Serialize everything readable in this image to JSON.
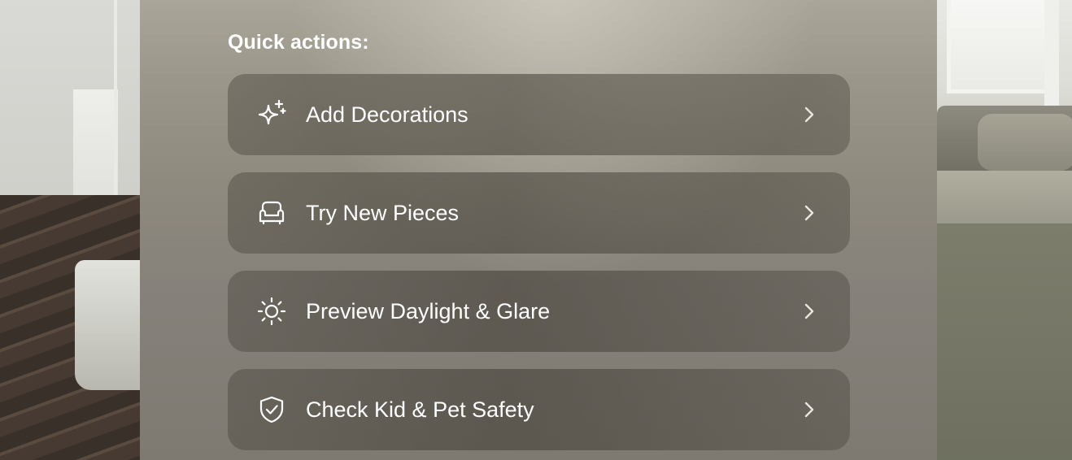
{
  "panel": {
    "title": "Quick actions:",
    "actions": [
      {
        "label": "Add Decorations",
        "icon": "sparkles-icon"
      },
      {
        "label": "Try New Pieces",
        "icon": "armchair-icon"
      },
      {
        "label": "Preview Daylight & Glare",
        "icon": "sun-icon"
      },
      {
        "label": "Check Kid & Pet Safety",
        "icon": "shield-check-icon"
      }
    ]
  },
  "colors": {
    "text": "#ffffff",
    "row_background": "#4a463e"
  }
}
